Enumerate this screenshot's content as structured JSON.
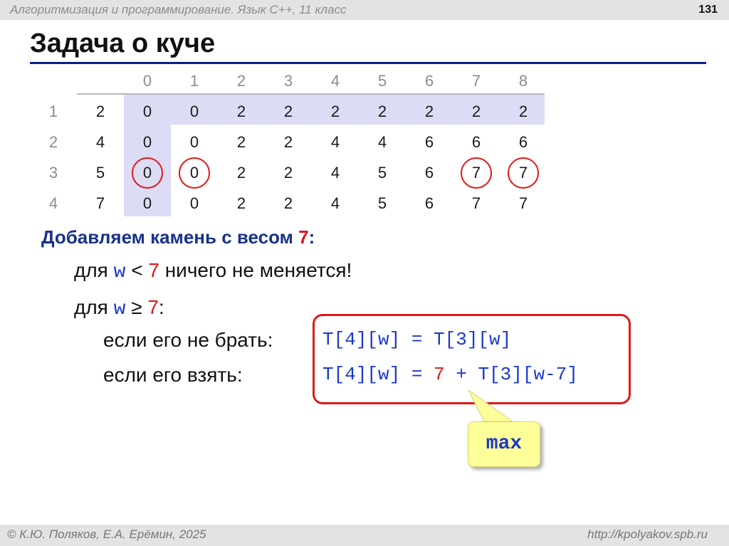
{
  "header": {
    "course": "Алгоритмизация и программирование. Язык С++, 11 класс",
    "page_number": "131"
  },
  "slide": {
    "title": "Задача о куче"
  },
  "table": {
    "columns": [
      "0",
      "1",
      "2",
      "3",
      "4",
      "5",
      "6",
      "7",
      "8"
    ],
    "rows": [
      {
        "index": "1",
        "weight": "2",
        "cells": [
          "0",
          "0",
          "2",
          "2",
          "2",
          "2",
          "2",
          "2",
          "2"
        ]
      },
      {
        "index": "2",
        "weight": "4",
        "cells": [
          "0",
          "0",
          "2",
          "2",
          "4",
          "4",
          "6",
          "6",
          "6"
        ]
      },
      {
        "index": "3",
        "weight": "5",
        "cells": [
          "0",
          "0",
          "2",
          "2",
          "4",
          "5",
          "6",
          "7",
          "7"
        ]
      },
      {
        "index": "4",
        "weight": "7",
        "cells": [
          "0",
          "0",
          "2",
          "2",
          "4",
          "5",
          "6",
          "7",
          "7"
        ]
      }
    ],
    "circled_cells": [
      {
        "row": 3,
        "col": 0
      },
      {
        "row": 3,
        "col": 1
      },
      {
        "row": 3,
        "col": 7
      },
      {
        "row": 3,
        "col": 8
      }
    ]
  },
  "text": {
    "add_stone_prefix": "Добавляем камень с весом ",
    "add_stone_weight": "7",
    "add_stone_suffix": ":",
    "line1_prefix": "для ",
    "line1_var": "w",
    "line1_op": " < ",
    "line1_value": "7",
    "line1_suffix": " ничего не меняется!",
    "line2_prefix": "для ",
    "line2_var": "w",
    "line2_op": " ≥ ",
    "line2_value": "7",
    "line2_suffix": ":",
    "line3_label": "если его не брать:",
    "line4_label": "если его взять:"
  },
  "formulas": {
    "not_take": "T[4][w] = T[3][w]",
    "take_prefix": "T[4][w] = ",
    "take_weight": "7",
    "take_suffix": " + T[3][w-7]"
  },
  "callout": {
    "label": "max"
  },
  "footer": {
    "author": "© К.Ю. Поляков, Е.А. Ерёмин, 2025",
    "site": "http://kpolyakov.spb.ru"
  },
  "colors": {
    "title_rule": "#0b1f8a",
    "highlight": "#dcdcf5",
    "accent_red": "#e01818",
    "code_blue": "#1c38c8",
    "callout_bg": "#ffff99"
  }
}
